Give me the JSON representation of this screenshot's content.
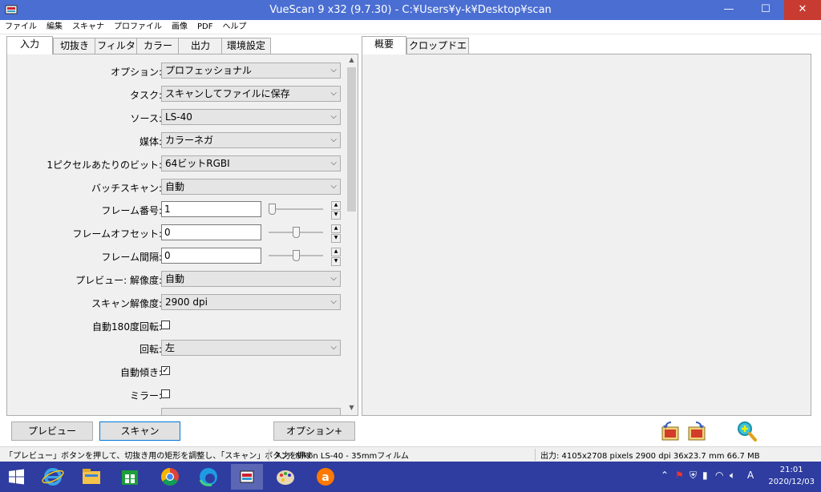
{
  "window": {
    "title": "VueScan 9 x32 (9.7.30) - C:¥Users¥y-k¥Desktop¥scan",
    "minimize": "—",
    "maximize": "☐",
    "close": "✕"
  },
  "menu": [
    "ファイル",
    "編集",
    "スキャナ",
    "プロファイル",
    "画像",
    "PDF",
    "ヘルプ"
  ],
  "left_tabs": [
    "入力",
    "切抜き",
    "フィルタ",
    "カラー",
    "出力",
    "環境設定"
  ],
  "right_tabs": [
    "概要",
    "クロップドエリア"
  ],
  "settings": {
    "option": {
      "label": "オプション:",
      "value": "プロフェッショナル"
    },
    "task": {
      "label": "タスク:",
      "value": "スキャンしてファイルに保存"
    },
    "source": {
      "label": "ソース:",
      "value": "LS-40"
    },
    "media": {
      "label": "媒体:",
      "value": "カラーネガ"
    },
    "bits": {
      "label": "1ピクセルあたりのビット:",
      "value": "64ビットRGBI"
    },
    "batch": {
      "label": "バッチスキャン:",
      "value": "自動"
    },
    "frame_number": {
      "label": "フレーム番号:",
      "value": "1",
      "slider_fraction": 0.0
    },
    "frame_offset": {
      "label": "フレームオフセット:",
      "value": "0",
      "slider_fraction": 0.5
    },
    "frame_spacing": {
      "label": "フレーム間隔:",
      "value": "0",
      "slider_fraction": 0.5
    },
    "preview_res": {
      "label": "プレビュー: 解像度:",
      "value": "自動"
    },
    "scan_res": {
      "label": "スキャン解像度:",
      "value": "2900 dpi"
    },
    "auto_rotate": {
      "label": "自動180度回転:",
      "checked": false
    },
    "rotate": {
      "label": "回転:",
      "value": "左"
    },
    "auto_skew": {
      "label": "自動傾き:",
      "checked": true
    },
    "mirror": {
      "label": "ミラー:",
      "checked": false
    }
  },
  "buttons": {
    "preview": "プレビュー",
    "scan": "スキャン",
    "options": "オプション+"
  },
  "status": {
    "hint": "「プレビュー」ボタンを押して、切抜き用の矩形を調整し、「スキャン」ボタンを押す",
    "input": "入力: Nikon LS-40 - 35mmフィルム",
    "output": "出力: 4105x2708 pixels 2900 dpi 36x23.7 mm 66.7 MB"
  },
  "taskbar": {
    "time": "21:01",
    "date": "2020/12/03",
    "ime": "A"
  },
  "colors": {
    "titlebar": "#4a6ed2",
    "taskbar": "#2e3d9f",
    "close": "#c73b31"
  }
}
